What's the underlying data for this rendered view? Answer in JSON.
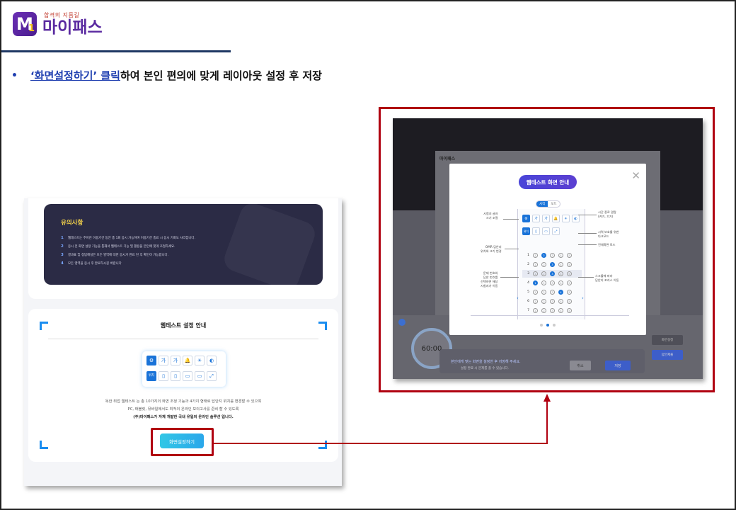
{
  "logo": {
    "sub": "합격의 지름길",
    "name": "마이패스",
    "mark": "M",
    "mark_sub": "1"
  },
  "instruction": {
    "bullet": "•",
    "link_text": "‘화면설정하기’ 클릭",
    "rest_text": "하여 본인 편의에 맞게 레이아웃 설정 후 저장"
  },
  "notice": {
    "title": "유의사항",
    "items": [
      {
        "num": "1",
        "text": "웹테스트는 주어진 이용기간 동안 총 1회 응시 가능하며 이용기간 종료 시 응시 기회도 사라집니다."
      },
      {
        "num": "2",
        "text": "응시 전 화면 설정 기능을 통해서 웹테스트 기능 및 활용을 본인에 맞게 조절하세요."
      },
      {
        "num": "3",
        "text": "결과표 및 정답해설은 모든 영역에 대한 응시가 완료 된 후 확인이 가능합니다."
      },
      {
        "num": "4",
        "text": "모든 영역을 응시 후 완료하시길 바랍니다"
      }
    ]
  },
  "guide": {
    "title": "웹테스트 설정 안내",
    "desc_line1": "독한 취업 웹테스트 는 총 10가지의 화면 조정 기능과 4가지 형태로 답안지 위치를 변경할 수 있으며",
    "desc_line2": "PC, 태블릿, 뮤바일에서도 최적의 온라인 모의고사를 준비 할 수 있도록",
    "desc_line3": "(주)마이패스가 자체 개발한 국내 유일의 온라인 솔루션 입니다.",
    "button": "화면설정하기",
    "icons_row1": [
      "⚙",
      "가",
      "가",
      "🔔",
      "☀",
      "◐"
    ],
    "icons_row2": [
      "위치",
      "▯",
      "▯",
      "▭",
      "▭",
      "⤢"
    ]
  },
  "right": {
    "page_title": "마이패스",
    "timer": "60:00",
    "bar_text": "본인에게 맞는 화면을 설정한 후 저장해 주세요.",
    "bar_sub": "설정 완료 시 문제를 풀 수 있습니다.",
    "cancel": "취소",
    "ok": "저장",
    "side1": "화면설정",
    "side2": "답안제출",
    "modal": {
      "title": "웹테스트 화면 안내",
      "close": "✕",
      "tabs": [
        "시작",
        "모드"
      ],
      "annotations": [
        {
          "text": "시험지 글자\n크기 조절"
        },
        {
          "text": "시간 종료 알람\n(켜기, 끄기)"
        },
        {
          "text": "시력 보호를 위한\n다크모드"
        },
        {
          "text": "전체화면 모드"
        },
        {
          "text": "OMR 답안지\n위치와 크기 변경"
        },
        {
          "text": "문제 번호와\n답안 번호를\n선택하면 해당\n시험지가 이동"
        },
        {
          "text": "스크롤에 따라\n답안지 포커스 이동"
        }
      ],
      "icons_row1": [
        "⚙",
        "가",
        "가",
        "🔔",
        "☀",
        "◐"
      ],
      "icons_row2": [
        "위치",
        "▯",
        "▭",
        "⤢"
      ],
      "answer_rows": [
        {
          "n": "1",
          "marks": [
            "1",
            "2",
            "3",
            "4",
            "5"
          ],
          "on": 1
        },
        {
          "n": "2",
          "marks": [
            "1",
            "2",
            "3",
            "4",
            "5"
          ],
          "on": 2
        },
        {
          "n": "3",
          "marks": [
            "1",
            "2",
            "3",
            "4",
            "5"
          ],
          "on": 2
        },
        {
          "n": "4",
          "marks": [
            "1",
            "2",
            "3",
            "4",
            "5"
          ],
          "on": 0
        },
        {
          "n": "5",
          "marks": [
            "1",
            "2",
            "3",
            "4",
            "5"
          ],
          "on": 3
        },
        {
          "n": "6",
          "marks": [
            "1",
            "2",
            "3",
            "4",
            "5"
          ],
          "on": -1
        },
        {
          "n": "7",
          "marks": [
            "1",
            "2",
            "3",
            "4",
            "5"
          ],
          "on": -1
        }
      ],
      "nav_prev": "‹",
      "nav_next": "›"
    },
    "prev_arrow": "‹",
    "next_arrow": "›"
  },
  "colors": {
    "highlight": "#b00010",
    "accent": "#1a73d8",
    "header_rule": "#1f3864"
  }
}
